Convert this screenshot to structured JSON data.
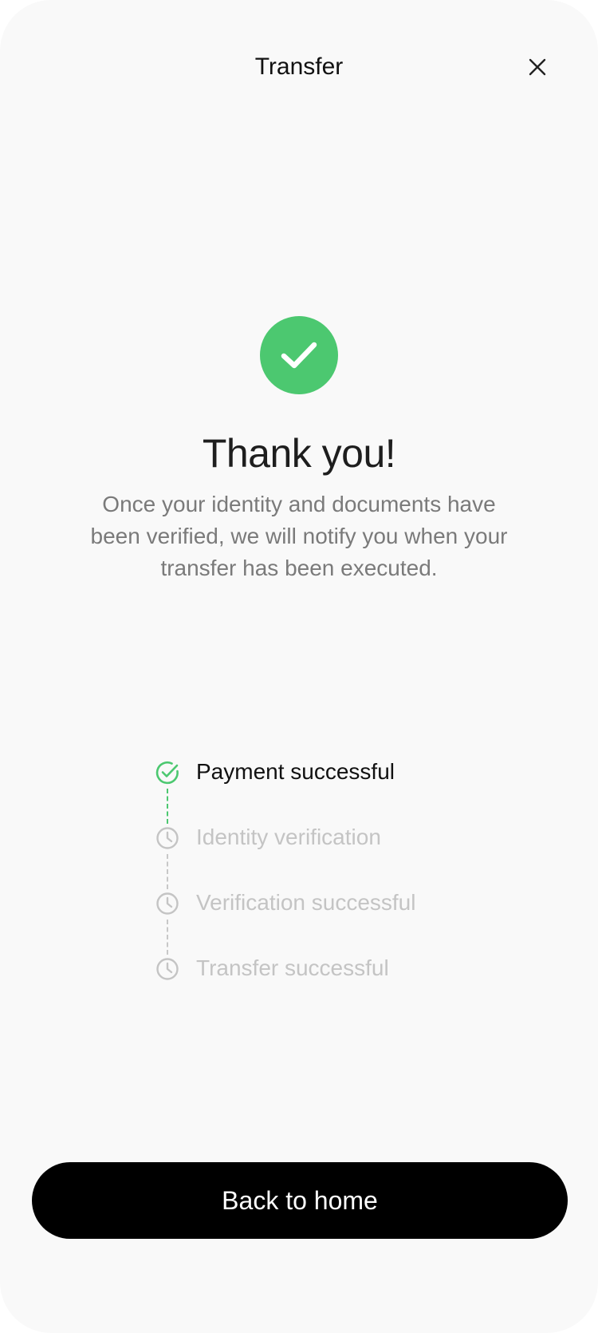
{
  "header": {
    "title": "Transfer",
    "close_icon": "close-icon"
  },
  "success": {
    "icon": "check-icon",
    "color": "#4cc870",
    "title": "Thank you!",
    "message": "Once your identity and documents have been verified, we will notify you when your transfer has been executed."
  },
  "steps": [
    {
      "label": "Payment successful",
      "status": "done",
      "icon": "check-circle-icon"
    },
    {
      "label": "Identity verification",
      "status": "pending",
      "icon": "clock-icon"
    },
    {
      "label": "Verification successful",
      "status": "pending",
      "icon": "clock-icon"
    },
    {
      "label": "Transfer successful",
      "status": "pending",
      "icon": "clock-icon"
    }
  ],
  "colors": {
    "accent": "#4cc870",
    "pending": "#c4c4c4",
    "button_bg": "#000000",
    "background": "#f9f9f9"
  },
  "footer": {
    "button_label": "Back to home"
  }
}
